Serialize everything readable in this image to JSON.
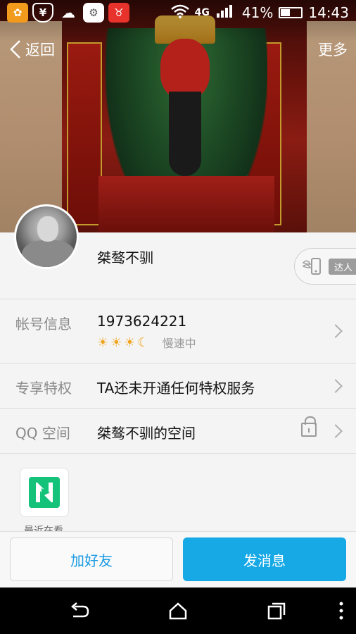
{
  "status_bar": {
    "battery": "41%",
    "time": "14:43",
    "network": "4G"
  },
  "nav": {
    "back_label": "返回",
    "more_label": "更多"
  },
  "profile": {
    "nickname": "桀骜不驯",
    "talent_badge": "达人"
  },
  "account": {
    "label": "帐号信息",
    "number": "1973624221",
    "speed_label": "慢速中"
  },
  "privilege": {
    "label": "专享特权",
    "value": "TA还未开通任何特权服务"
  },
  "qzone": {
    "label": "QQ 空间",
    "value": "桀骜不驯的空间"
  },
  "recent": {
    "label": "最近在看"
  },
  "actions": {
    "add_friend": "加好友",
    "send_message": "发消息"
  },
  "colors": {
    "accent": "#16a9e6",
    "accent_text": "#1b9be3",
    "sun": "#f0a31a",
    "app_green": "#15c27a"
  }
}
